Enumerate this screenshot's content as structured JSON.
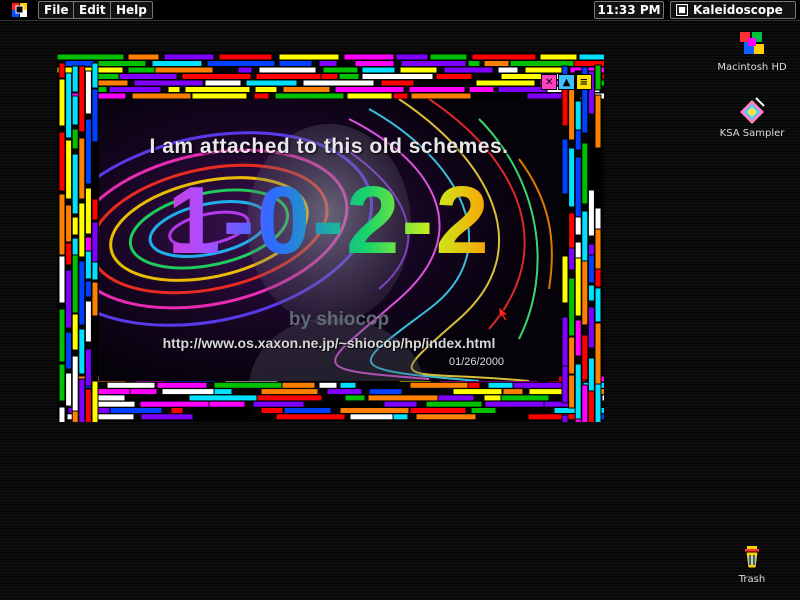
{
  "menubar": {
    "menus": [
      "File",
      "Edit",
      "Help"
    ],
    "clock": "11:33 PM",
    "active_app": "Kaleidoscope"
  },
  "desktop_icons": {
    "hd": "Macintosh HD",
    "sampler": "KSA Sampler",
    "trash": "Trash"
  },
  "window": {
    "headline": "I am attached to this old schemes.",
    "big_number": "1-0-2-2",
    "byline": "by shiocop",
    "url": "http://www.os.xaxon.ne.jp/~shiocop/hp/index.html",
    "date": "01/26/2000"
  },
  "colors": {
    "frame": [
      "#ff0000",
      "#ffff00",
      "#00c000",
      "#0040ff",
      "#ffffff",
      "#ff00ff",
      "#00e0ff",
      "#ff8000",
      "#8000ff",
      "#000000"
    ]
  }
}
